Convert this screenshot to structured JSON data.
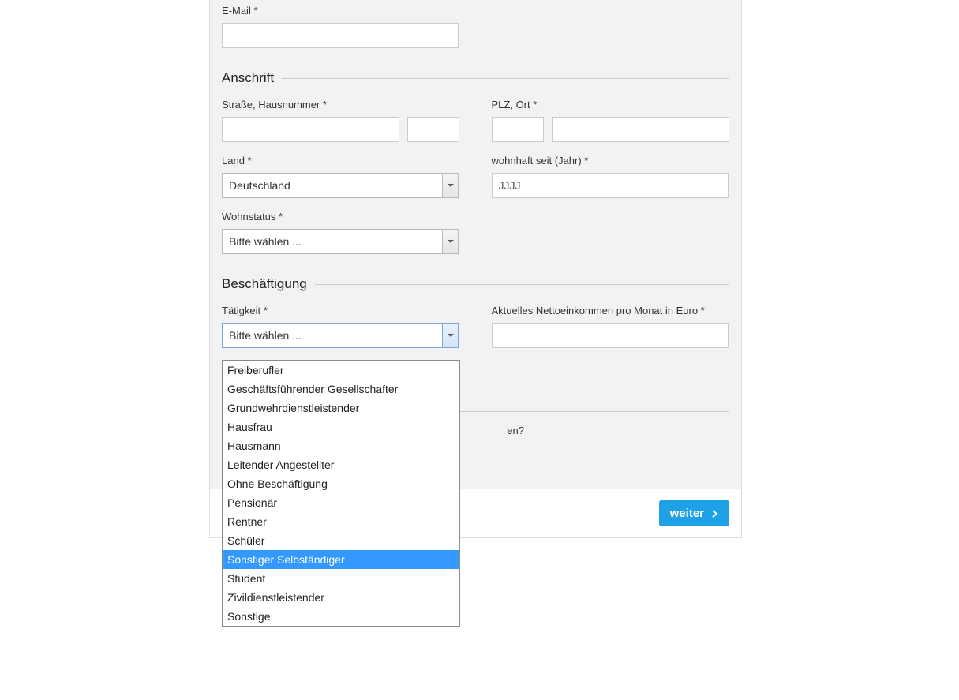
{
  "email": {
    "label": "E-Mail *"
  },
  "section_address": "Anschrift",
  "street": {
    "label": "Straße, Hausnummer *"
  },
  "plz_ort": {
    "label": "PLZ, Ort *"
  },
  "country": {
    "label": "Land *",
    "value": "Deutschland"
  },
  "resident_since": {
    "label": "wohnhaft seit (Jahr) *",
    "placeholder": "JJJJ"
  },
  "housing_status": {
    "label": "Wohnstatus *",
    "value": "Bitte wählen ..."
  },
  "section_employment": "Beschäftigung",
  "activity": {
    "label": "Tätigkeit *",
    "value": "Bitte wählen ...",
    "options": [
      "Freiberufler",
      "Geschäftsführender Gesellschafter",
      "Grundwehrdienstleistender",
      "Hausfrau",
      "Hausmann",
      "Leitender Angestellter",
      "Ohne Beschäftigung",
      "Pensionär",
      "Rentner",
      "Schüler",
      "Sonstiger Selbständiger",
      "Student",
      "Zivildienstleistender",
      "Sonstige"
    ],
    "highlighted": "Sonstiger Selbständiger"
  },
  "income": {
    "label": "Aktuelles Nettoeinkommen pro Monat in Euro *"
  },
  "hidden_question_suffix": "en?",
  "button_next": "weiter"
}
